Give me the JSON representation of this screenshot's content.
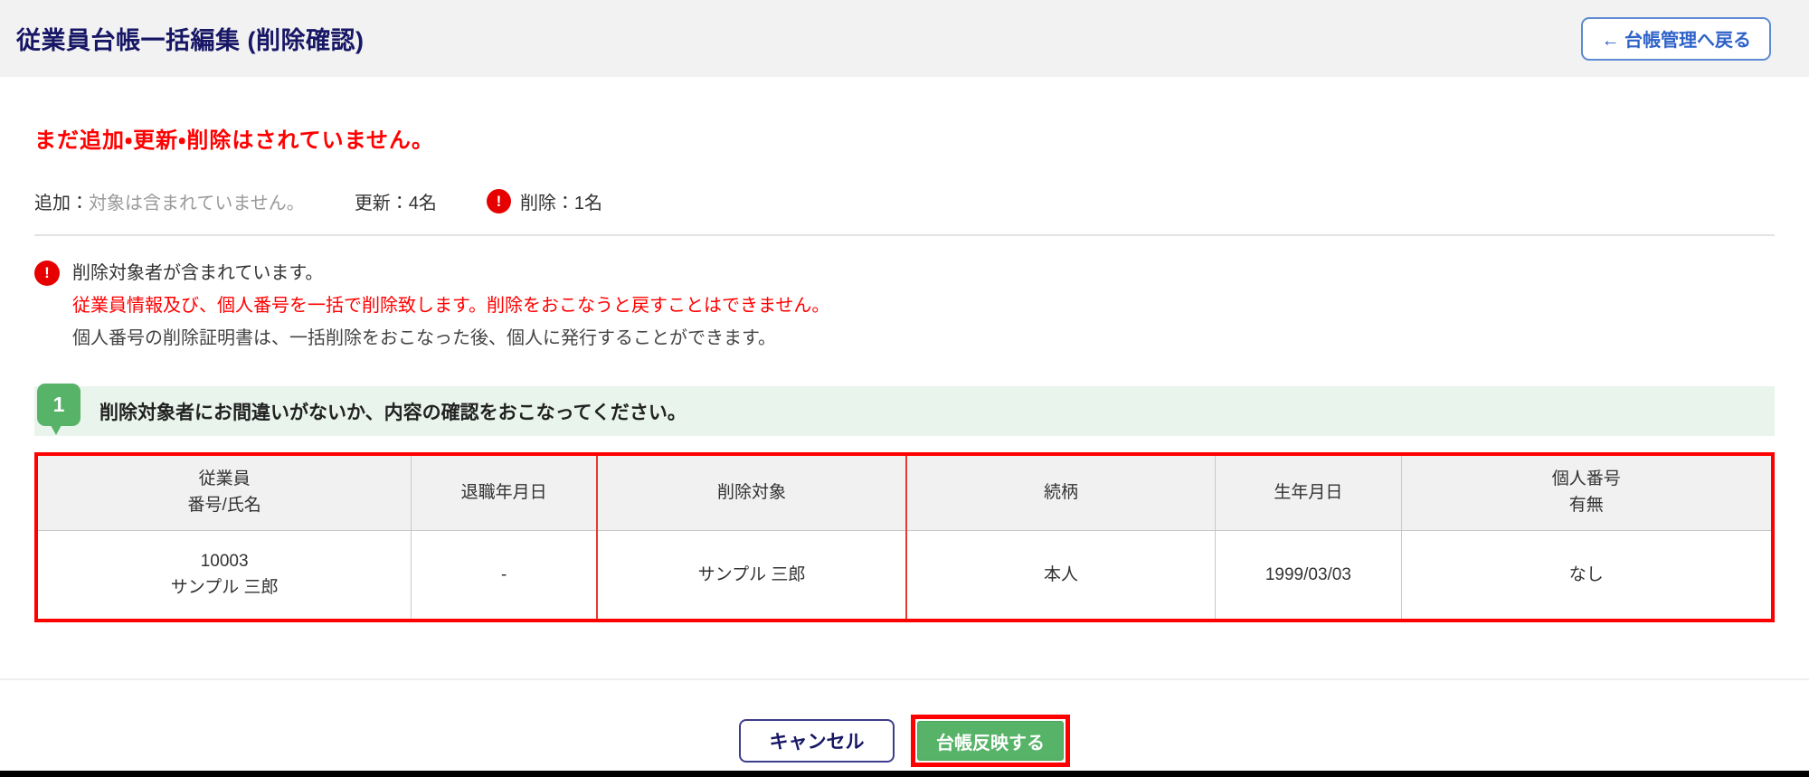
{
  "header": {
    "title": "従業員台帳一括編集 (削除確認)",
    "back_button": "← 台帳管理へ戻る"
  },
  "notice": "まだ追加・更新・削除はされていません。",
  "summary": {
    "add_label": "追加：",
    "add_value": "対象は含まれていません。",
    "update_label": "更新：4名",
    "alert_icon": "!",
    "delete_label": "削除：1名"
  },
  "warning": {
    "icon": "!",
    "line1": "削除対象者が含まれています。",
    "line2": "従業員情報及び、個人番号を一括で削除致します。削除をおこなうと戻すことはできません。",
    "line3": "個人番号の削除証明書は、一括削除をおこなった後、個人に発行することができます。"
  },
  "step": {
    "number": "1",
    "instruction": "削除対象者にお間違いがないか、内容の確認をおこなってください。"
  },
  "table": {
    "columns": [
      {
        "line1": "従業員",
        "line2": "番号/氏名"
      },
      {
        "line1": "退職年月日"
      },
      {
        "line1": "削除対象"
      },
      {
        "line1": "続柄"
      },
      {
        "line1": "生年月日"
      },
      {
        "line1": "個人番号",
        "line2": "有無"
      }
    ],
    "rows": [
      {
        "employee_no": "10003",
        "employee_name": "サンプル 三郎",
        "retirement_date": "-",
        "delete_target": "サンプル 三郎",
        "relationship": "本人",
        "birth_date": "1999/03/03",
        "my_number": "なし"
      }
    ]
  },
  "footer": {
    "cancel_label": "キャンセル",
    "apply_label": "台帳反映する"
  },
  "colors": {
    "title_navy": "#171766",
    "accent_blue": "#2f62c8",
    "alert_red": "#ff0000",
    "badge_red": "#e60000",
    "success_green": "#57b368",
    "light_green_bg": "#e9f4ec",
    "muted_gray": "#9a9a9a"
  }
}
